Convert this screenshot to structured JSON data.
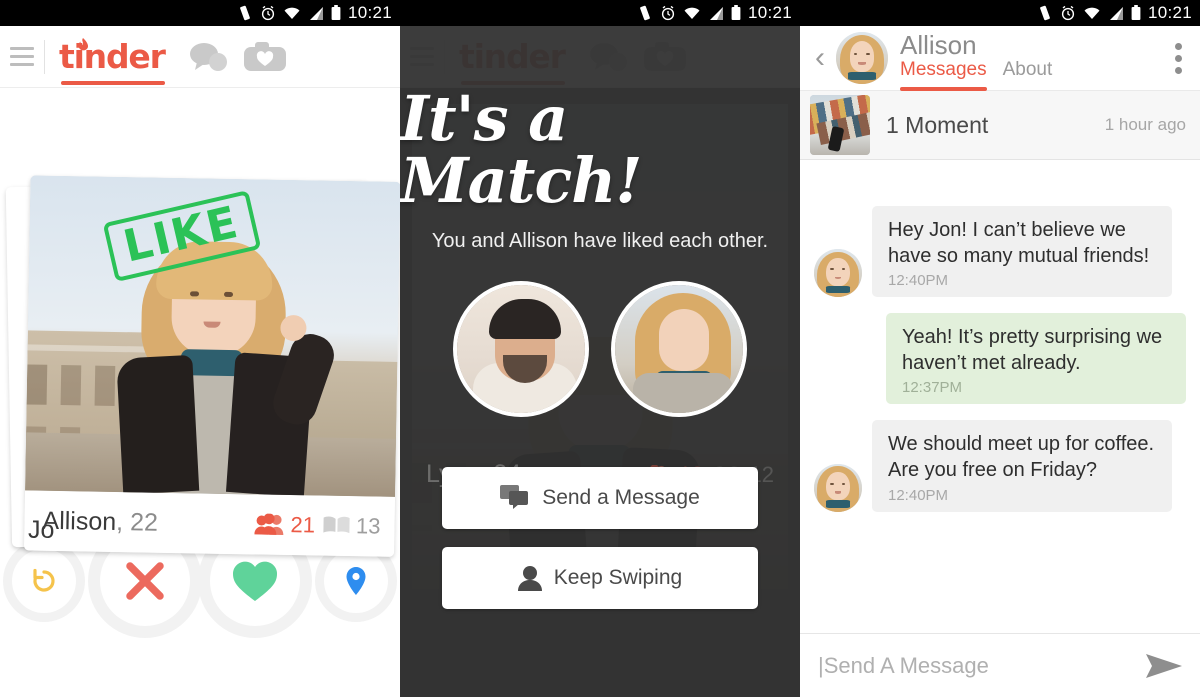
{
  "status_bar": {
    "time": "10:21",
    "icons": [
      "vibrate-icon",
      "alarm-icon",
      "wifi-icon",
      "signal-icon",
      "battery-icon"
    ]
  },
  "colors": {
    "brand_orange": "#eb5a46",
    "like_green": "#2bc257",
    "nope_red": "#ec6a5e",
    "heart_green": "#5fd39a",
    "rewind_yellow": "#f5c34b",
    "location_blue": "#2e8def",
    "match_bg": "#424242",
    "bubble_them": "#f0f0f0",
    "bubble_me": "#e2f0db"
  },
  "screen_swipe": {
    "nav": {
      "menu_icon": "hamburger-icon",
      "logo": "tinder",
      "messages_icon": "chat-bubbles-icon",
      "moments_icon": "camera-heart-icon"
    },
    "stamp": "LIKE",
    "card": {
      "name": "Allison",
      "age": "22",
      "friends_count": "21",
      "interests_count": "13",
      "friends_icon": "people-icon",
      "interests_icon": "book-icon"
    },
    "behind_card_name": "Jo",
    "actions": [
      {
        "name": "rewind-button",
        "icon": "rewind-icon",
        "color": "#f5c34b"
      },
      {
        "name": "nope-button",
        "icon": "x-icon",
        "color": "#ec6a5e"
      },
      {
        "name": "like-button",
        "icon": "heart-icon",
        "color": "#5fd39a"
      },
      {
        "name": "location-button",
        "icon": "map-pin-icon",
        "color": "#2e8def"
      }
    ]
  },
  "screen_match": {
    "title": "It's a Match!",
    "subtitle": "You and Allison have liked each other.",
    "avatars": [
      "avatar-you",
      "avatar-allison"
    ],
    "behind_card": {
      "name": "Lynn",
      "age": "24",
      "friends_count": "18",
      "interests_count": "12"
    },
    "buttons": [
      {
        "label": "Send a Message",
        "icon": "chat-bubbles-icon"
      },
      {
        "label": "Keep Swiping",
        "icon": "person-icon"
      }
    ]
  },
  "screen_chat": {
    "header": {
      "back_icon": "back-chevron-icon",
      "name": "Allison",
      "tabs": [
        {
          "label": "Messages",
          "active": true
        },
        {
          "label": "About",
          "active": false
        }
      ],
      "overflow_icon": "kebab-menu-icon"
    },
    "moment": {
      "title": "1 Moment",
      "time": "1 hour ago",
      "thumb": "moment-thumbnail"
    },
    "messages": [
      {
        "from": "them",
        "text": "Hey Jon! I can’t believe we have so many mutual friends!",
        "time": "12:40PM"
      },
      {
        "from": "me",
        "text": "Yeah! It’s pretty surprising we haven’t met already.",
        "time": "12:37PM"
      },
      {
        "from": "them",
        "text": "We should meet up for coffee. Are you free on Friday?",
        "time": "12:40PM"
      }
    ],
    "input": {
      "placeholder": "|Send A Message",
      "send_icon": "send-arrow-icon"
    }
  }
}
